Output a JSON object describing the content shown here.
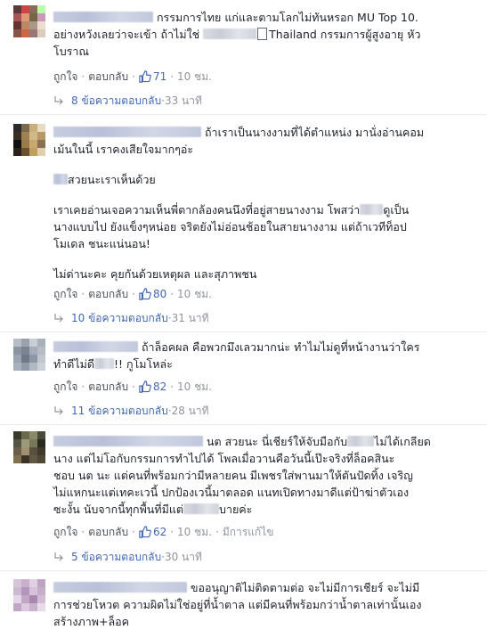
{
  "actions": {
    "like": "ถูกใจ",
    "reply": "ตอบกลับ",
    "sep": "·",
    "edited": "มีการแก้ไข"
  },
  "colors": {
    "link": "#4267b2",
    "meta": "#90949c",
    "text": "#1d2129",
    "divider": "#e9ebee"
  },
  "comments": [
    {
      "text_a": "กรรมการไทย แก่และตามโลกไม่ทันหรอก MU Top 10.",
      "text_b": "อย่างหวังเลยว่าจะเข้า ถ้าไม่ใช่",
      "text_c": "Thailand กรรมการผู้สูงอายุ หัว",
      "text_d": "โบราณ",
      "likes": "71",
      "time": "10 ชม.",
      "replies_label": "8 ข้อความตอบกลับ",
      "replies_time": "33 นาที"
    },
    {
      "p1_a": "ถ้าเราเป็นนางงามที่ได้ตำแหน่ง มานั่งอ่านคอม",
      "p1_b": "เม้นในนี้ เราคงเสียใจมากๆอ่ะ",
      "p2": "สวยนะเราเห็นด้วย",
      "p3_a": "เราเคยอ่านเจอความเห็นพี่ตากล้องคนนึงที่อยู่สายนางงาม โพสว่า",
      "p3_a2": "ดูเป็น",
      "p3_b": "นางแบบไป ยังแข็งๆหน่อย จริตยังไม่อ่อนช้อยในสายนางงาม แต่ถ้าเวทีท็อป",
      "p3_c": "โมเดล ชนะแน่นอน!",
      "p4": "ไม่ด่านะคะ คุยกันด้วยเหตุผล และสุภาพชน",
      "likes": "80",
      "time": "10 ชม.",
      "replies_label": "10 ข้อความตอบกลับ",
      "replies_time": "31 นาที"
    },
    {
      "text_a": "ถ้าล็อคผล คือพวกมึงเลวมากน่ะ ทำไมไม่ดูที่หน้างานว่าใคร",
      "text_b": "ทำดีไม่ดี",
      "text_b2": "!! กูโมโหล่ะ",
      "likes": "82",
      "time": "10 ชม.",
      "replies_label": "11 ข้อความตอบกลับ",
      "replies_time": "28 นาที"
    },
    {
      "text_a": "นต สวยนะ นี่เชียร์ให้จับมือกับ",
      "text_a2": "ไม่ได้เกลียด",
      "text_b": "นาง แต่ไม่โอกับกรรมการทำไปได้ โพลเมื่อวานคือวันนี้เป๊ะจริงที่ล็อคสินะ",
      "text_c": "ชอบ นต นะ แต่คนที่พร้อมกว่ามีหลายคน มีเพชรใส่พานมาให้ตันปัดทิ้ง เจริญ",
      "text_d": "ไม่แหกนะแต่เทคะเวนี้ ปกป้องเวนี้มาตลอด แนทเปิดทางมาดีแต่ป้าฆ่าตัวเอง",
      "text_e": "ซะงั้น นับจากนี้ทุกพื้นที่มีแต่",
      "text_e2": "บายค่ะ",
      "likes": "62",
      "time": "10 ชม.",
      "replies_label": "5 ข้อความตอบกลับ",
      "replies_time": "30 นาที"
    },
    {
      "text_a": "ขออนุญาติไม่ติดตามต่อ จะไม่มีการเชียร์ จะไม่มี",
      "text_b": "การช่วยโหวต ความผิดไม่ใช่อยู่ที่น้ำตาล แต่มีคนที่พร้อมกว่าน้ำตาลเท่านั้นเอง",
      "text_c": "สร้างภาพ+ล็อค"
    }
  ]
}
